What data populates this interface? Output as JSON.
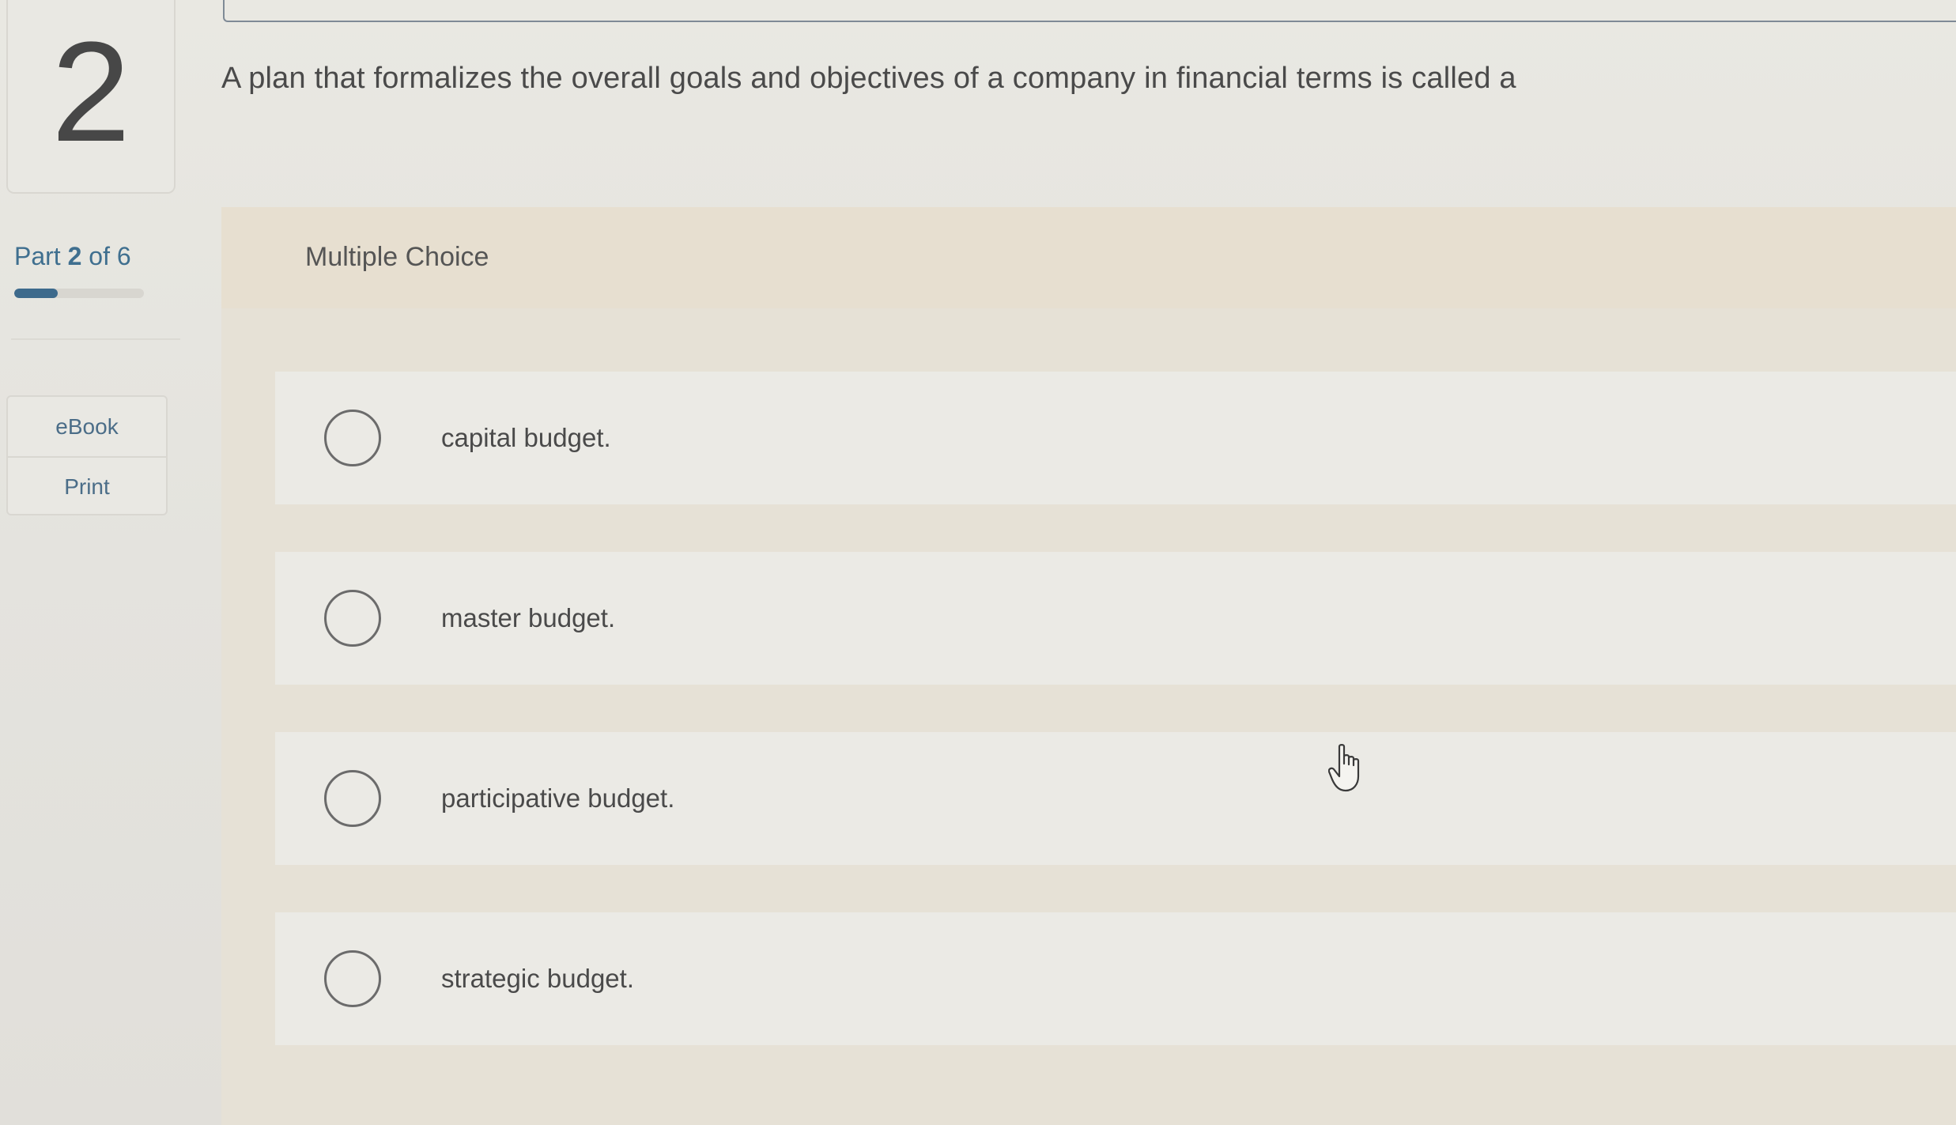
{
  "question": {
    "number": "2",
    "text": "A plan that formalizes the overall goals and objectives of a company in financial terms is called a"
  },
  "part": {
    "prefix": "Part ",
    "current": "2",
    "suffix": " of 6",
    "progress_fraction": 0.333
  },
  "tools": {
    "ebook": "eBook",
    "print": "Print"
  },
  "answer": {
    "type_label": "Multiple Choice",
    "choices": [
      {
        "label": "capital budget.",
        "selected": false
      },
      {
        "label": "master budget.",
        "selected": false
      },
      {
        "label": "participative budget.",
        "selected": false
      },
      {
        "label": "strategic budget.",
        "selected": false
      }
    ]
  },
  "colors": {
    "accent": "#3d6a8c",
    "panel_header": "#e7dfd0",
    "choice_bg": "#ebeae5"
  },
  "icons": {
    "cursor": "hand-pointer-icon"
  }
}
